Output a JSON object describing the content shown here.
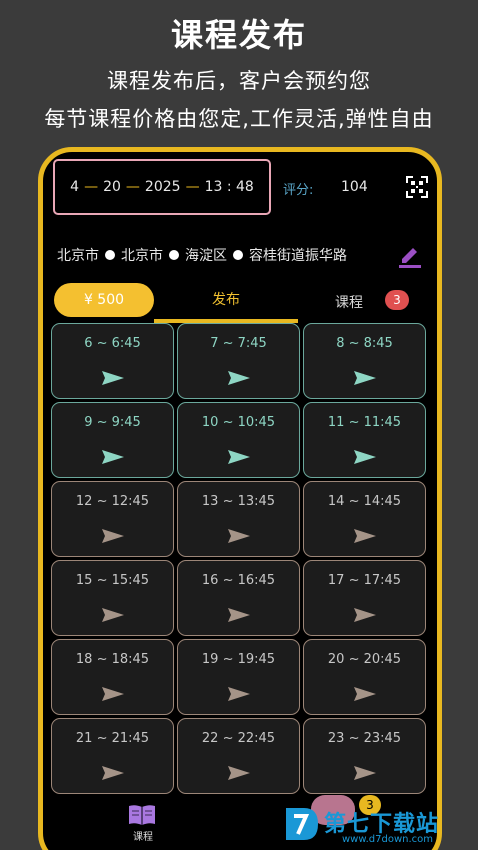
{
  "promo": {
    "title": "课程发布",
    "line1": "课程发布后，客户会预约您",
    "line2": "每节课程价格由您定,工作灵活,弹性自由"
  },
  "header": {
    "date_month": "4",
    "date_day": "20",
    "date_year": "2025",
    "time": "13 : 48",
    "score_label": "评分:",
    "score_value": "104"
  },
  "address": {
    "province": "北京市",
    "city": "北京市",
    "district": "海淀区",
    "street": "容桂街道振华路"
  },
  "tabs": {
    "balance": "¥ 500",
    "publish": "发布",
    "course": "课程",
    "course_badge": "3"
  },
  "slots": [
    {
      "label": "6 ~ 6:45",
      "available": true
    },
    {
      "label": "7 ~ 7:45",
      "available": true
    },
    {
      "label": "8 ~ 8:45",
      "available": true
    },
    {
      "label": "9 ~ 9:45",
      "available": true
    },
    {
      "label": "10 ~ 10:45",
      "available": true
    },
    {
      "label": "11 ~ 11:45",
      "available": true
    },
    {
      "label": "12 ~ 12:45",
      "available": false
    },
    {
      "label": "13 ~ 13:45",
      "available": false
    },
    {
      "label": "14 ~ 14:45",
      "available": false
    },
    {
      "label": "15 ~ 15:45",
      "available": false
    },
    {
      "label": "16 ~ 16:45",
      "available": false
    },
    {
      "label": "17 ~ 17:45",
      "available": false
    },
    {
      "label": "18 ~ 18:45",
      "available": false
    },
    {
      "label": "19 ~ 19:45",
      "available": false
    },
    {
      "label": "20 ~ 20:45",
      "available": false
    },
    {
      "label": "21 ~ 21:45",
      "available": false
    },
    {
      "label": "22 ~ 22:45",
      "available": false
    },
    {
      "label": "23 ~ 23:45",
      "available": false
    }
  ],
  "bottom_nav": {
    "course_label": "课程",
    "float_badge": "3"
  },
  "watermark": {
    "text": "第七下载站",
    "url": "www.d7down.com"
  },
  "colors": {
    "accent_yellow": "#e8b820",
    "available_border": "#6ba89c",
    "past_border": "#9c8678",
    "score_blue": "#5aa6c8",
    "badge_red": "#e05050"
  }
}
